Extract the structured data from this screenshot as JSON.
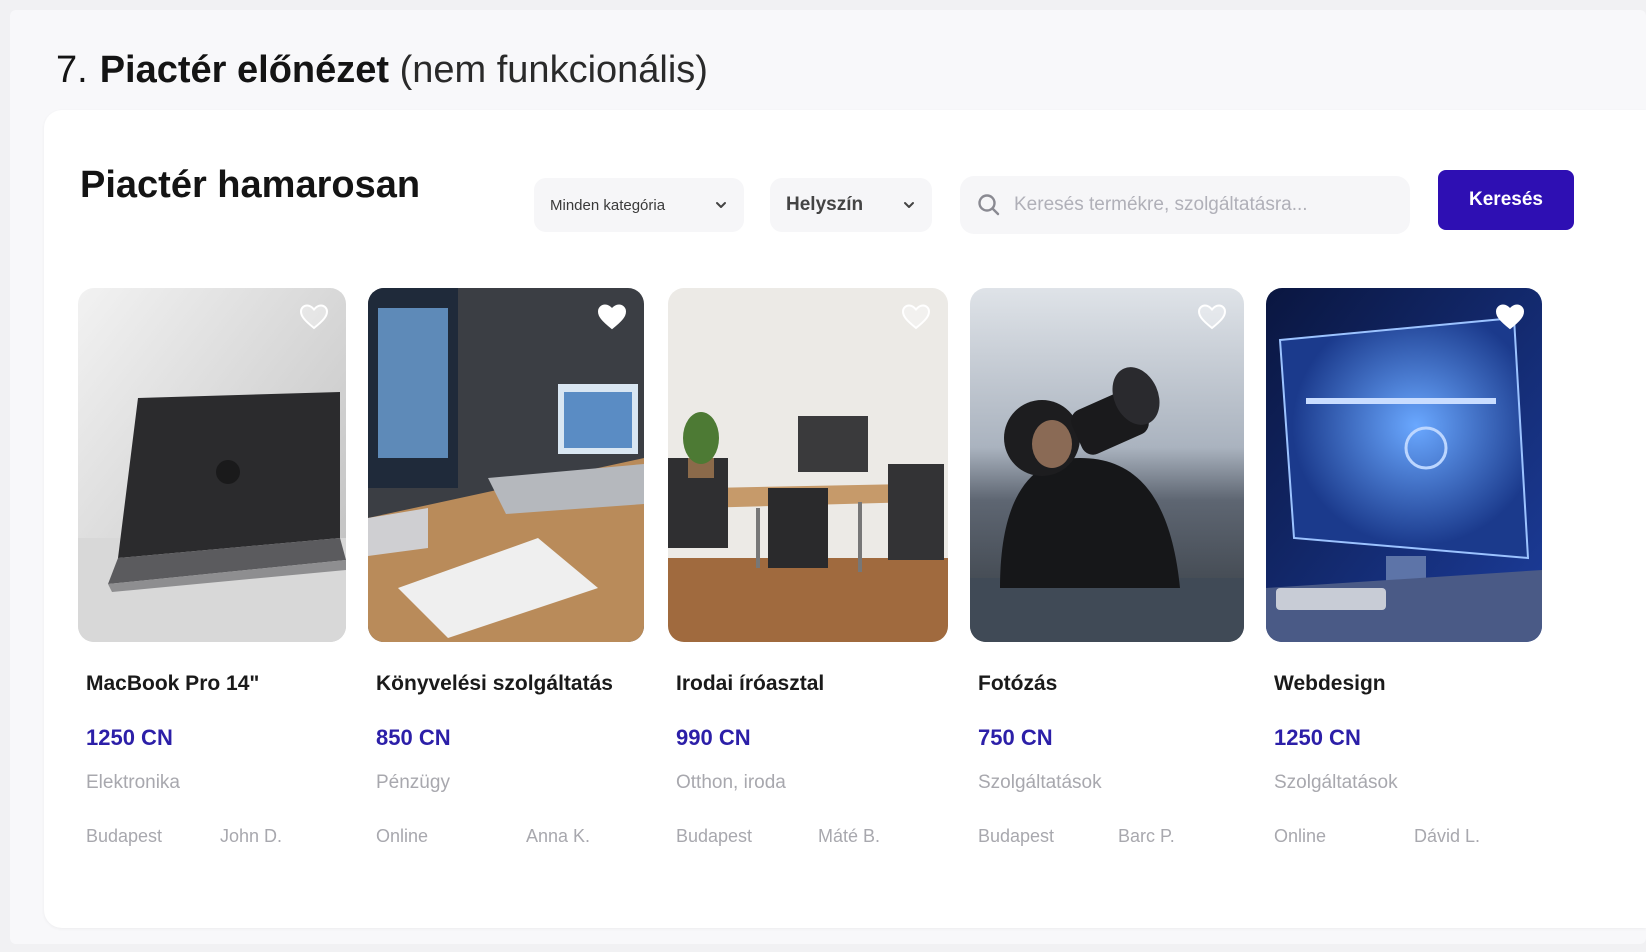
{
  "section": {
    "number": "7.",
    "title": "Piactér előnézet",
    "note": "(nem funkcionális)"
  },
  "marketplace": {
    "title": "Piactér hamarosan",
    "category_filter": {
      "selected": "Minden kategória",
      "icon": "chevron-down-icon"
    },
    "location_filter": {
      "selected": "Helyszín",
      "icon": "chevron-down-icon"
    },
    "search": {
      "placeholder": "Keresés termékre, szolgáltatásra...",
      "value": "",
      "icon": "search-icon"
    },
    "search_button": "Keresés",
    "accent_color": "#2e0fb3",
    "price_color": "#2c1fa8"
  },
  "products": [
    {
      "title": "MacBook Pro 14\"",
      "price": "1250 CN",
      "category": "Elektronika",
      "location": "Budapest",
      "seller": "John D.",
      "favorited": false,
      "image": "dark laptop on white desk"
    },
    {
      "title": "Könyvelési szolgáltatás",
      "price": "850 CN",
      "category": "Pénzügy",
      "location": "Online",
      "seller": "Anna K.",
      "favorited": true,
      "image": "office desk with laptop and notebook"
    },
    {
      "title": "Irodai íróasztal",
      "price": "990 CN",
      "category": "Otthon, iroda",
      "location": "Budapest",
      "seller": "Máté B.",
      "favorited": false,
      "image": "office room with table and chairs"
    },
    {
      "title": "Fotózás",
      "price": "750 CN",
      "category": "Szolgáltatások",
      "location": "Budapest",
      "seller": "Barc P.",
      "favorited": false,
      "image": "photographer with large lens"
    },
    {
      "title": "Webdesign",
      "price": "1250 CN",
      "category": "Szolgáltatások",
      "location": "Online",
      "seller": "Dávid L.",
      "favorited": true,
      "image": "glowing blue monitor"
    }
  ]
}
